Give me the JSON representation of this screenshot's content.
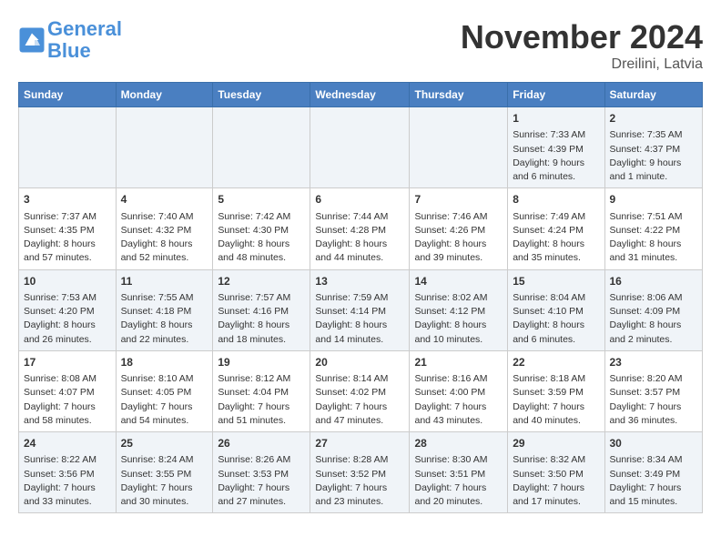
{
  "header": {
    "logo_line1": "General",
    "logo_line2": "Blue",
    "month_year": "November 2024",
    "location": "Dreilini, Latvia"
  },
  "weekdays": [
    "Sunday",
    "Monday",
    "Tuesday",
    "Wednesday",
    "Thursday",
    "Friday",
    "Saturday"
  ],
  "weeks": [
    [
      {
        "day": "",
        "info": ""
      },
      {
        "day": "",
        "info": ""
      },
      {
        "day": "",
        "info": ""
      },
      {
        "day": "",
        "info": ""
      },
      {
        "day": "",
        "info": ""
      },
      {
        "day": "1",
        "info": "Sunrise: 7:33 AM\nSunset: 4:39 PM\nDaylight: 9 hours and 6 minutes."
      },
      {
        "day": "2",
        "info": "Sunrise: 7:35 AM\nSunset: 4:37 PM\nDaylight: 9 hours and 1 minute."
      }
    ],
    [
      {
        "day": "3",
        "info": "Sunrise: 7:37 AM\nSunset: 4:35 PM\nDaylight: 8 hours and 57 minutes."
      },
      {
        "day": "4",
        "info": "Sunrise: 7:40 AM\nSunset: 4:32 PM\nDaylight: 8 hours and 52 minutes."
      },
      {
        "day": "5",
        "info": "Sunrise: 7:42 AM\nSunset: 4:30 PM\nDaylight: 8 hours and 48 minutes."
      },
      {
        "day": "6",
        "info": "Sunrise: 7:44 AM\nSunset: 4:28 PM\nDaylight: 8 hours and 44 minutes."
      },
      {
        "day": "7",
        "info": "Sunrise: 7:46 AM\nSunset: 4:26 PM\nDaylight: 8 hours and 39 minutes."
      },
      {
        "day": "8",
        "info": "Sunrise: 7:49 AM\nSunset: 4:24 PM\nDaylight: 8 hours and 35 minutes."
      },
      {
        "day": "9",
        "info": "Sunrise: 7:51 AM\nSunset: 4:22 PM\nDaylight: 8 hours and 31 minutes."
      }
    ],
    [
      {
        "day": "10",
        "info": "Sunrise: 7:53 AM\nSunset: 4:20 PM\nDaylight: 8 hours and 26 minutes."
      },
      {
        "day": "11",
        "info": "Sunrise: 7:55 AM\nSunset: 4:18 PM\nDaylight: 8 hours and 22 minutes."
      },
      {
        "day": "12",
        "info": "Sunrise: 7:57 AM\nSunset: 4:16 PM\nDaylight: 8 hours and 18 minutes."
      },
      {
        "day": "13",
        "info": "Sunrise: 7:59 AM\nSunset: 4:14 PM\nDaylight: 8 hours and 14 minutes."
      },
      {
        "day": "14",
        "info": "Sunrise: 8:02 AM\nSunset: 4:12 PM\nDaylight: 8 hours and 10 minutes."
      },
      {
        "day": "15",
        "info": "Sunrise: 8:04 AM\nSunset: 4:10 PM\nDaylight: 8 hours and 6 minutes."
      },
      {
        "day": "16",
        "info": "Sunrise: 8:06 AM\nSunset: 4:09 PM\nDaylight: 8 hours and 2 minutes."
      }
    ],
    [
      {
        "day": "17",
        "info": "Sunrise: 8:08 AM\nSunset: 4:07 PM\nDaylight: 7 hours and 58 minutes."
      },
      {
        "day": "18",
        "info": "Sunrise: 8:10 AM\nSunset: 4:05 PM\nDaylight: 7 hours and 54 minutes."
      },
      {
        "day": "19",
        "info": "Sunrise: 8:12 AM\nSunset: 4:04 PM\nDaylight: 7 hours and 51 minutes."
      },
      {
        "day": "20",
        "info": "Sunrise: 8:14 AM\nSunset: 4:02 PM\nDaylight: 7 hours and 47 minutes."
      },
      {
        "day": "21",
        "info": "Sunrise: 8:16 AM\nSunset: 4:00 PM\nDaylight: 7 hours and 43 minutes."
      },
      {
        "day": "22",
        "info": "Sunrise: 8:18 AM\nSunset: 3:59 PM\nDaylight: 7 hours and 40 minutes."
      },
      {
        "day": "23",
        "info": "Sunrise: 8:20 AM\nSunset: 3:57 PM\nDaylight: 7 hours and 36 minutes."
      }
    ],
    [
      {
        "day": "24",
        "info": "Sunrise: 8:22 AM\nSunset: 3:56 PM\nDaylight: 7 hours and 33 minutes."
      },
      {
        "day": "25",
        "info": "Sunrise: 8:24 AM\nSunset: 3:55 PM\nDaylight: 7 hours and 30 minutes."
      },
      {
        "day": "26",
        "info": "Sunrise: 8:26 AM\nSunset: 3:53 PM\nDaylight: 7 hours and 27 minutes."
      },
      {
        "day": "27",
        "info": "Sunrise: 8:28 AM\nSunset: 3:52 PM\nDaylight: 7 hours and 23 minutes."
      },
      {
        "day": "28",
        "info": "Sunrise: 8:30 AM\nSunset: 3:51 PM\nDaylight: 7 hours and 20 minutes."
      },
      {
        "day": "29",
        "info": "Sunrise: 8:32 AM\nSunset: 3:50 PM\nDaylight: 7 hours and 17 minutes."
      },
      {
        "day": "30",
        "info": "Sunrise: 8:34 AM\nSunset: 3:49 PM\nDaylight: 7 hours and 15 minutes."
      }
    ]
  ]
}
